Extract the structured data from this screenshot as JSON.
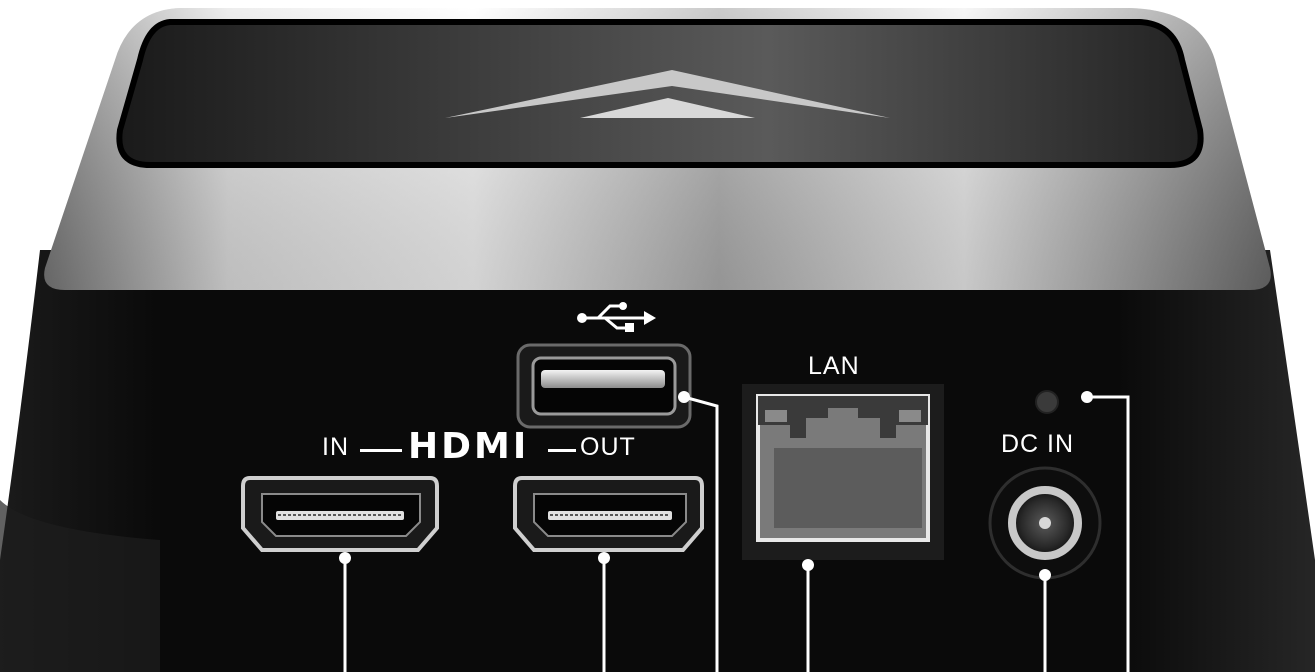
{
  "labels": {
    "hdmi_in": "IN",
    "hdmi_logo": "HDMI",
    "hdmi_out": "OUT",
    "lan": "LAN",
    "dc_in": "DC IN"
  },
  "icons": {
    "usb": "usb-icon",
    "hdmi_logo": "hdmi-logo"
  },
  "colors": {
    "body": "#0a0a0a",
    "silver_band": "#c8c8c8",
    "callout": "#ffffff"
  }
}
